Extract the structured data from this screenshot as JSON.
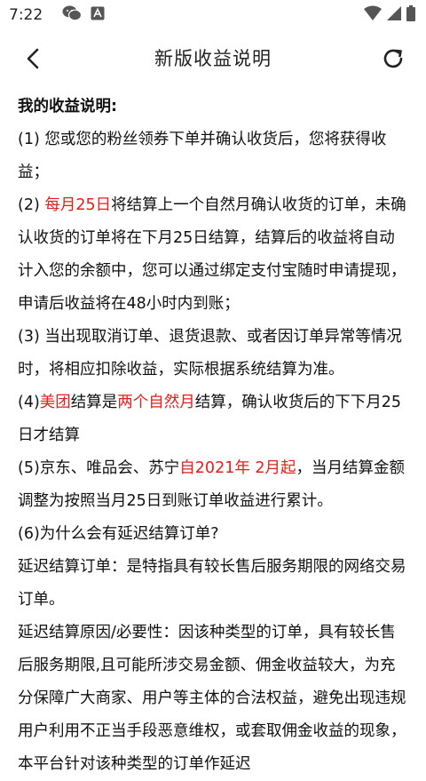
{
  "status_bar": {
    "time": "7:22",
    "left_icons": [
      "wechat-icon",
      "app-notification-icon"
    ],
    "right_icons": [
      "wifi-icon",
      "cellular-signal-icon",
      "battery-icon"
    ]
  },
  "header": {
    "title": "新版收益说明",
    "back_icon": "chevron-left-icon",
    "refresh_icon": "refresh-icon"
  },
  "colors": {
    "accent_red": "#e0201c",
    "text": "#111111"
  },
  "content": {
    "heading": "我的收益说明:",
    "item1": "(1) 您或您的粉丝领券下单并确认收货后，您将获得收益；",
    "item2": {
      "prefix": "(2) ",
      "highlight": "每月25日",
      "rest": "将结算上一个自然月确认收货的订单，未确认收货的订单将在下月25日结算，结算后的收益将自动计入您的余额中，您可以通过绑定支付宝随时申请提现，申请后收益将在48小时内到账；"
    },
    "item3": "(3) 当出现取消订单、退货退款、或者因订单异常等情况时，将相应扣除收益，实际根据系统结算为准。",
    "item4": {
      "prefix": "(4)",
      "highlight1": "美团",
      "mid": "结算是",
      "highlight2": "两个自然月",
      "rest": "结算，确认收货后的下下月25日才结算"
    },
    "item5": {
      "prefix": "(5)京东、唯品会、苏宁",
      "highlight": "自2021年 2月起",
      "rest": "，当月结算金额调整为按照当月25日到账订单收益进行累计。"
    },
    "item6": "(6)为什么会有延迟结算订单?",
    "item6_answer": "延迟结算订单：是特指具有较长售后服务期限的网络交易订单。",
    "item6_reason": "延迟结算原因/必要性：因该种类型的订单，具有较长售后服务期限,且可能所涉交易金额、佣金收益较大，为充分保障广大商家、用户等主体的合法权益，避免出现违规用户利用不正当手段恶意维权，或套取佣金收益的现象，本平台针对该种类型的订单作延迟"
  }
}
